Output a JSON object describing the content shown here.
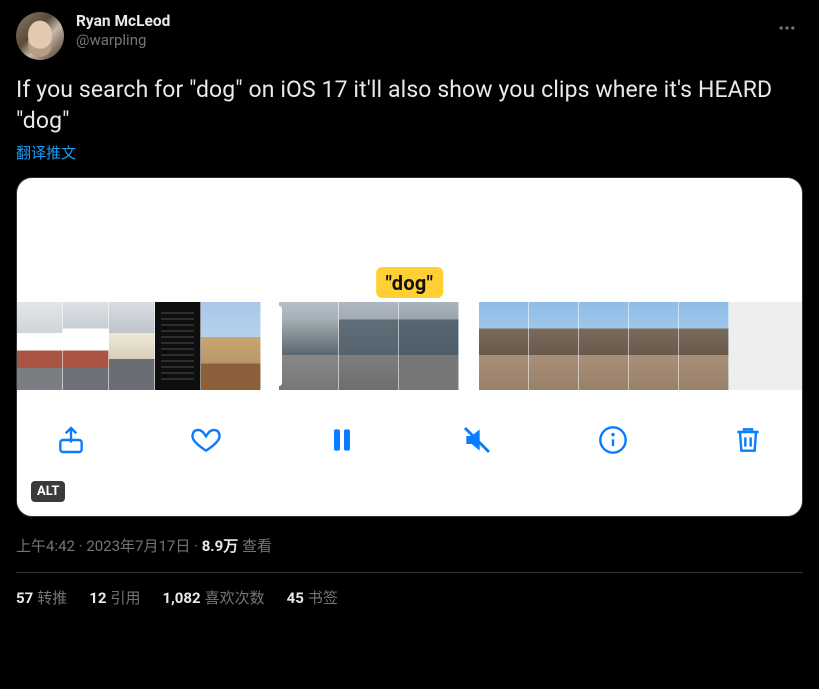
{
  "author": {
    "display_name": "Ryan McLeod",
    "handle": "@warpling"
  },
  "text": "If you search for \"dog\" on iOS 17 it'll also show you clips where it's HEARD \"dog\"",
  "translate_label": "翻译推文",
  "media": {
    "search_tag": "\"dog\"",
    "alt_badge": "ALT"
  },
  "meta": {
    "time": "上午4:42",
    "date": "2023年7月17日",
    "views_count": "8.9万",
    "views_label": "查看",
    "dot": " · "
  },
  "stats": {
    "retweets": {
      "count": "57",
      "label": "转推"
    },
    "quotes": {
      "count": "12",
      "label": "引用"
    },
    "likes": {
      "count": "1,082",
      "label": "喜欢次数"
    },
    "bookmarks": {
      "count": "45",
      "label": "书签"
    }
  }
}
